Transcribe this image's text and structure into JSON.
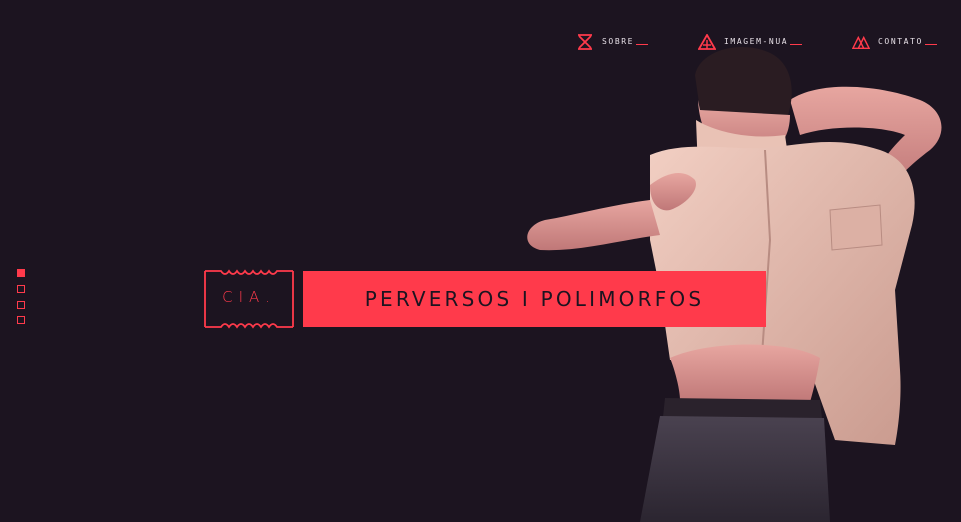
{
  "nav": {
    "items": [
      {
        "label": "SOBRE",
        "icon": "hourglass-x-icon"
      },
      {
        "label": "IMAGEM-NUA",
        "icon": "tent-triangle-icon"
      },
      {
        "label": "CONTATO",
        "icon": "mountain-triangle-icon"
      }
    ]
  },
  "brand": {
    "prefix": "CIA.",
    "name": "PERVERSOS I POLIMORFOS"
  },
  "slider": {
    "total": 4,
    "active": 1
  },
  "colors": {
    "background": "#1c1420",
    "accent": "#ff3a4b",
    "nav_text": "#e6dfe6"
  }
}
